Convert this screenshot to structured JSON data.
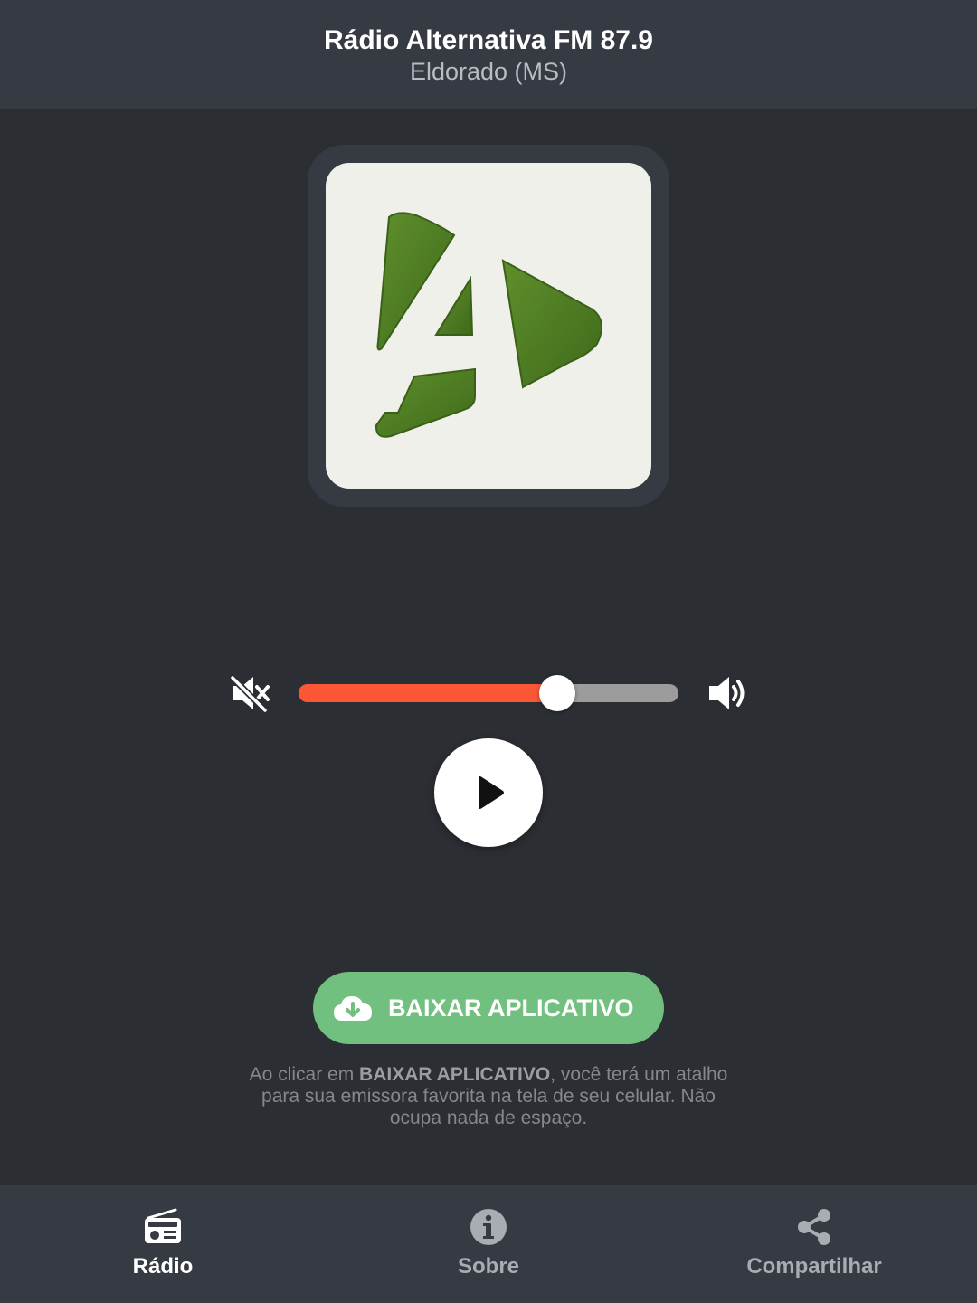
{
  "header": {
    "title": "Rádio Alternativa FM 87.9",
    "subtitle": "Eldorado (MS)"
  },
  "logo": {
    "icon": "alternativa-logo-icon",
    "colors": {
      "background": "#f0f0ea",
      "mark": "#4f7a22"
    }
  },
  "player": {
    "volume_percent": 68,
    "mute_icon": "volume-mute-icon",
    "max_icon": "volume-up-icon",
    "play_icon": "play-icon",
    "colors": {
      "fill": "#fb5636",
      "track": "#9c9c9c"
    }
  },
  "download": {
    "label": "BAIXAR APLICATIVO",
    "icon": "cloud-download-icon",
    "color": "#72c07f",
    "info_before": "Ao clicar em ",
    "info_bold": "BAIXAR APLICATIVO",
    "info_after": ", você terá um atalho para sua emissora favorita na tela de seu celular. Não ocupa nada de espaço."
  },
  "nav": {
    "items": [
      {
        "label": "Rádio",
        "icon": "radio-icon",
        "active": true
      },
      {
        "label": "Sobre",
        "icon": "info-icon",
        "active": false
      },
      {
        "label": "Compartilhar",
        "icon": "share-icon",
        "active": false
      }
    ]
  }
}
